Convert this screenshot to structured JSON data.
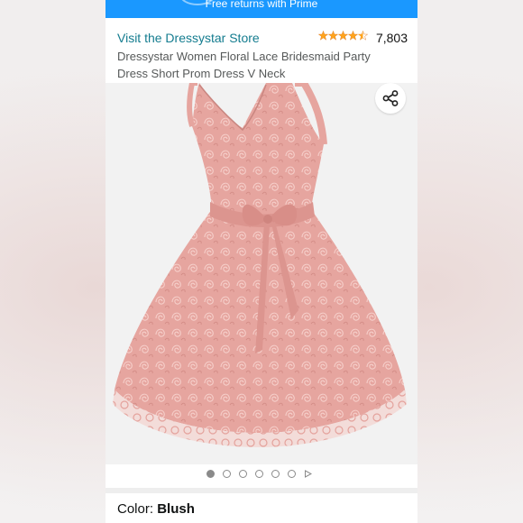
{
  "banner": {
    "text": "Free returns with Prime"
  },
  "store": {
    "link_label": "Visit the Dressystar Store"
  },
  "rating": {
    "stars": 4.5,
    "count": "7,803",
    "star_color": "#ffa41c"
  },
  "product": {
    "title": "Dressystar Women Floral Lace Bridesmaid Party Dress Short Prom Dress V Neck"
  },
  "gallery": {
    "total_images": 6,
    "active_index": 0,
    "has_video": true
  },
  "variation": {
    "label": "Color:",
    "value": "Blush"
  },
  "colors": {
    "link": "#147c8f",
    "dress": "#e8a9a3",
    "banner": "#1a98ff"
  }
}
